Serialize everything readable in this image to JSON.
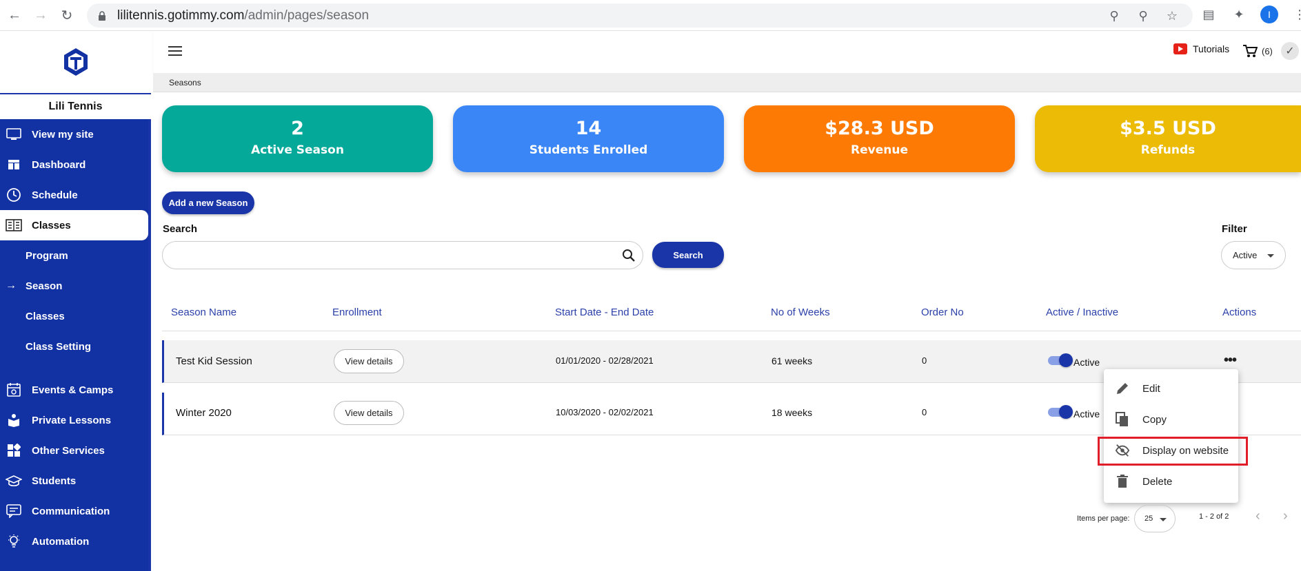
{
  "browser": {
    "url_host": "lilitennis.gotimmy.com",
    "url_path": "/admin/pages/season",
    "profile_initial": "I"
  },
  "sidebar": {
    "brand": "Lili Tennis",
    "items": [
      {
        "label": "View my site",
        "icon": "monitor-icon"
      },
      {
        "label": "Dashboard",
        "icon": "dashboard-icon"
      },
      {
        "label": "Schedule",
        "icon": "clock-icon"
      },
      {
        "label": "Classes",
        "icon": "book-icon"
      },
      {
        "label": "Program"
      },
      {
        "label": "Season"
      },
      {
        "label": "Classes"
      },
      {
        "label": "Class Setting"
      },
      {
        "label": "Events & Camps",
        "icon": "calendar-icon"
      },
      {
        "label": "Private Lessons",
        "icon": "lesson-icon"
      },
      {
        "label": "Other Services",
        "icon": "grid-icon"
      },
      {
        "label": "Students",
        "icon": "graduation-icon"
      },
      {
        "label": "Communication",
        "icon": "chat-icon"
      },
      {
        "label": "Automation",
        "icon": "bulb-icon"
      }
    ]
  },
  "topbar": {
    "tutorials": "Tutorials",
    "cart_count": "(6)"
  },
  "breadcrumb": "Seasons",
  "stats": [
    {
      "value": "2",
      "label": "Active Season",
      "color": "#05a99a"
    },
    {
      "value": "14",
      "label": "Students Enrolled",
      "color": "#3b86f6"
    },
    {
      "value": "$28.3 USD",
      "label": "Revenue",
      "color": "#fd7b05"
    },
    {
      "value": "$3.5 USD",
      "label": "Refunds",
      "color": "#ebbb05"
    }
  ],
  "controls": {
    "add_button": "Add a new Season",
    "search_label": "Search",
    "search_placeholder": "",
    "search_button": "Search",
    "filter_label": "Filter",
    "filter_value": "Active"
  },
  "table": {
    "columns": [
      "Season Name",
      "Enrollment",
      "Start Date - End Date",
      "No of Weeks",
      "Order No",
      "Active / Inactive",
      "Actions"
    ],
    "rows": [
      {
        "name": "Test Kid Session",
        "enrollment": "View details",
        "dates": "01/01/2020 - 02/28/2021",
        "weeks": "61 weeks",
        "order": "0",
        "status": "Active"
      },
      {
        "name": "Winter 2020",
        "enrollment": "View details",
        "dates": "10/03/2020 - 02/02/2021",
        "weeks": "18 weeks",
        "order": "0",
        "status": "Active"
      }
    ]
  },
  "actions_menu": {
    "items": [
      {
        "label": "Edit",
        "icon": "pencil-icon"
      },
      {
        "label": "Copy",
        "icon": "copy-icon"
      },
      {
        "label": "Display on website",
        "icon": "eye-off-icon"
      },
      {
        "label": "Delete",
        "icon": "trash-icon"
      }
    ]
  },
  "pagination": {
    "items_per_page_label": "Items per page:",
    "items_per_page": "25",
    "range": "1 - 2 of 2"
  }
}
